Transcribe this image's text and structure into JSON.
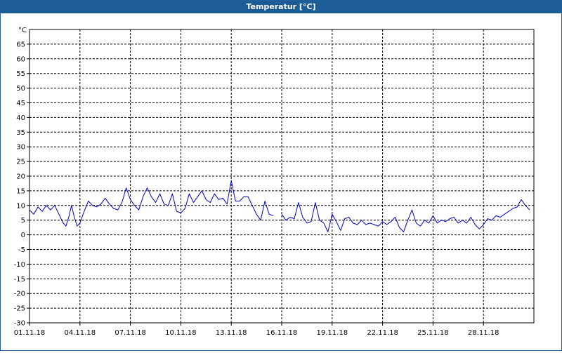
{
  "window": {
    "title": "Temperatur [°C]"
  },
  "chart_data": {
    "type": "line",
    "title": "Temperatur [°C]",
    "ylabel": "°C",
    "xlabel": "",
    "ylim": [
      -30,
      70
    ],
    "yticks": [
      -30,
      -25,
      -20,
      -15,
      -10,
      -5,
      0,
      5,
      10,
      15,
      20,
      25,
      30,
      35,
      40,
      45,
      50,
      55,
      60,
      65
    ],
    "xlim": [
      "2018-11-01",
      "2018-12-01"
    ],
    "xticks": [
      "2018-11-01",
      "2018-11-04",
      "2018-11-07",
      "2018-11-10",
      "2018-11-13",
      "2018-11-16",
      "2018-11-19",
      "2018-11-22",
      "2018-11-25",
      "2018-11-28"
    ],
    "xticklabels": [
      "01.11.18",
      "04.11.18",
      "07.11.18",
      "10.11.18",
      "13.11.18",
      "16.11.18",
      "19.11.18",
      "22.11.18",
      "25.11.18",
      "28.11.18"
    ],
    "grid": true,
    "line_color": "#0000cc",
    "series": [
      {
        "segments": [
          [
            [
              "2018-11-01 00:00",
              8.5
            ],
            [
              "2018-11-01 06:00",
              7.0
            ],
            [
              "2018-11-01 12:00",
              9.5
            ],
            [
              "2018-11-01 18:00",
              8.0
            ],
            [
              "2018-11-02 00:00",
              10.0
            ],
            [
              "2018-11-02 06:00",
              8.5
            ],
            [
              "2018-11-02 12:00",
              10.0
            ],
            [
              "2018-11-02 18:00",
              7.0
            ],
            [
              "2018-11-03 00:00",
              4.0
            ],
            [
              "2018-11-03 04:00",
              3.0
            ],
            [
              "2018-11-03 08:00",
              6.0
            ],
            [
              "2018-11-03 12:00",
              10.0
            ],
            [
              "2018-11-03 16:00",
              6.0
            ],
            [
              "2018-11-03 20:00",
              3.0
            ],
            [
              "2018-11-04 00:00",
              4.0
            ],
            [
              "2018-11-04 06:00",
              8.0
            ],
            [
              "2018-11-04 12:00",
              11.5
            ],
            [
              "2018-11-04 18:00",
              10.0
            ],
            [
              "2018-11-05 00:00",
              9.5
            ],
            [
              "2018-11-05 06:00",
              10.5
            ],
            [
              "2018-11-05 12:00",
              12.5
            ],
            [
              "2018-11-05 18:00",
              10.5
            ],
            [
              "2018-11-06 00:00",
              9.0
            ],
            [
              "2018-11-06 06:00",
              8.5
            ],
            [
              "2018-11-06 12:00",
              11.0
            ],
            [
              "2018-11-06 18:00",
              16.0
            ],
            [
              "2018-11-07 00:00",
              12.0
            ],
            [
              "2018-11-07 06:00",
              10.0
            ],
            [
              "2018-11-07 12:00",
              8.5
            ],
            [
              "2018-11-07 18:00",
              13.0
            ],
            [
              "2018-11-08 00:00",
              16.0
            ],
            [
              "2018-11-08 06:00",
              13.0
            ],
            [
              "2018-11-08 12:00",
              11.0
            ],
            [
              "2018-11-08 18:00",
              14.0
            ],
            [
              "2018-11-09 00:00",
              10.5
            ],
            [
              "2018-11-09 06:00",
              10.0
            ],
            [
              "2018-11-09 12:00",
              14.0
            ],
            [
              "2018-11-09 18:00",
              8.0
            ],
            [
              "2018-11-10 00:00",
              7.5
            ],
            [
              "2018-11-10 06:00",
              9.0
            ],
            [
              "2018-11-10 12:00",
              14.0
            ],
            [
              "2018-11-10 18:00",
              11.0
            ],
            [
              "2018-11-11 00:00",
              13.0
            ],
            [
              "2018-11-11 06:00",
              15.0
            ],
            [
              "2018-11-11 12:00",
              12.0
            ],
            [
              "2018-11-11 18:00",
              11.0
            ],
            [
              "2018-11-12 00:00",
              14.0
            ],
            [
              "2018-11-12 06:00",
              12.0
            ],
            [
              "2018-11-12 12:00",
              12.5
            ],
            [
              "2018-11-12 18:00",
              10.5
            ],
            [
              "2018-11-13 00:00",
              18.5
            ],
            [
              "2018-11-13 06:00",
              11.5
            ],
            [
              "2018-11-13 12:00",
              11.5
            ],
            [
              "2018-11-13 18:00",
              13.0
            ],
            [
              "2018-11-14 00:00",
              13.0
            ],
            [
              "2018-11-14 06:00",
              10.0
            ],
            [
              "2018-11-14 12:00",
              7.0
            ],
            [
              "2018-11-14 18:00",
              5.0
            ],
            [
              "2018-11-15 00:00",
              11.5
            ],
            [
              "2018-11-15 06:00",
              7.0
            ],
            [
              "2018-11-15 12:00",
              6.5
            ]
          ],
          [
            [
              "2018-11-16 00:00",
              7.0
            ],
            [
              "2018-11-16 06:00",
              5.0
            ],
            [
              "2018-11-16 12:00",
              6.0
            ],
            [
              "2018-11-16 18:00",
              5.5
            ],
            [
              "2018-11-17 00:00",
              11.0
            ],
            [
              "2018-11-17 06:00",
              6.0
            ],
            [
              "2018-11-17 12:00",
              4.0
            ],
            [
              "2018-11-17 18:00",
              4.5
            ],
            [
              "2018-11-18 00:00",
              11.0
            ],
            [
              "2018-11-18 06:00",
              5.0
            ],
            [
              "2018-11-18 12:00",
              4.0
            ],
            [
              "2018-11-18 18:00",
              1.0
            ],
            [
              "2018-11-19 00:00",
              7.0
            ],
            [
              "2018-11-19 06:00",
              4.5
            ],
            [
              "2018-11-19 12:00",
              1.5
            ],
            [
              "2018-11-19 18:00",
              5.5
            ],
            [
              "2018-11-20 00:00",
              6.0
            ],
            [
              "2018-11-20 06:00",
              4.0
            ],
            [
              "2018-11-20 12:00",
              3.5
            ],
            [
              "2018-11-20 18:00",
              5.0
            ],
            [
              "2018-11-21 00:00",
              3.5
            ],
            [
              "2018-11-21 06:00",
              4.0
            ],
            [
              "2018-11-21 12:00",
              3.5
            ],
            [
              "2018-11-21 18:00",
              3.0
            ],
            [
              "2018-11-22 00:00",
              4.5
            ],
            [
              "2018-11-22 06:00",
              3.5
            ],
            [
              "2018-11-22 12:00",
              4.5
            ],
            [
              "2018-11-22 18:00",
              6.0
            ],
            [
              "2018-11-23 00:00",
              2.5
            ],
            [
              "2018-11-23 06:00",
              1.0
            ],
            [
              "2018-11-23 12:00",
              5.0
            ],
            [
              "2018-11-23 18:00",
              8.5
            ],
            [
              "2018-11-24 00:00",
              4.0
            ],
            [
              "2018-11-24 06:00",
              3.0
            ],
            [
              "2018-11-24 12:00",
              5.0
            ],
            [
              "2018-11-24 18:00",
              4.0
            ],
            [
              "2018-11-25 00:00",
              6.5
            ],
            [
              "2018-11-25 06:00",
              4.0
            ],
            [
              "2018-11-25 12:00",
              5.0
            ],
            [
              "2018-11-25 18:00",
              4.5
            ],
            [
              "2018-11-26 00:00",
              5.5
            ],
            [
              "2018-11-26 06:00",
              6.0
            ],
            [
              "2018-11-26 12:00",
              4.0
            ],
            [
              "2018-11-26 18:00",
              5.0
            ],
            [
              "2018-11-27 00:00",
              4.0
            ],
            [
              "2018-11-27 06:00",
              6.0
            ],
            [
              "2018-11-27 12:00",
              3.5
            ],
            [
              "2018-11-27 18:00",
              2.0
            ],
            [
              "2018-11-28 00:00",
              3.5
            ],
            [
              "2018-11-28 06:00",
              5.5
            ],
            [
              "2018-11-28 12:00",
              5.0
            ],
            [
              "2018-11-28 18:00",
              6.5
            ],
            [
              "2018-11-29 00:00",
              6.0
            ],
            [
              "2018-11-29 06:00",
              7.0
            ],
            [
              "2018-11-29 12:00",
              8.0
            ],
            [
              "2018-11-29 18:00",
              9.0
            ],
            [
              "2018-11-30 00:00",
              9.5
            ],
            [
              "2018-11-30 06:00",
              12.0
            ],
            [
              "2018-11-30 12:00",
              10.0
            ],
            [
              "2018-11-30 18:00",
              8.5
            ]
          ]
        ]
      }
    ]
  }
}
